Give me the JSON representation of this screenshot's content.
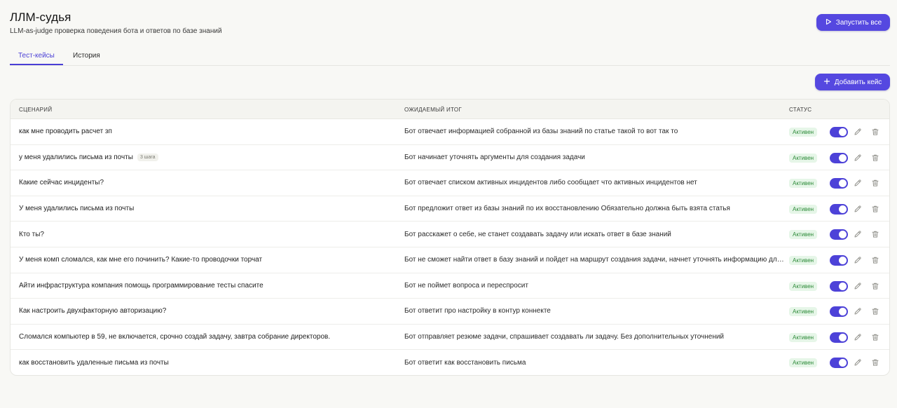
{
  "header": {
    "title": "ЛЛМ-судья",
    "subtitle": "LLM-as-judge проверка поведения бота и ответов по базе знаний",
    "run_all_label": "Запустить все"
  },
  "tabs": [
    {
      "label": "Тест-кейсы",
      "active": true
    },
    {
      "label": "История",
      "active": false
    }
  ],
  "toolbar": {
    "add_case_label": "Добавить кейс"
  },
  "table": {
    "columns": {
      "scenario": "СЦЕНАРИЙ",
      "expected": "ОЖИДАЕМЫЙ ИТОГ",
      "status": "СТАТУС"
    },
    "rows": [
      {
        "scenario": "как мне проводить расчет зп",
        "steps": "",
        "expected": "Бот отвечает информацией собранной из базы знаний по статье такой то вот так то",
        "status": "Активен",
        "enabled": true
      },
      {
        "scenario": "у меня удалились письма из почты",
        "steps": "3 шага",
        "expected": "Бот начинает уточнять аргументы для создания задачи",
        "status": "Активен",
        "enabled": true
      },
      {
        "scenario": "Какие сейчас инциденты?",
        "steps": "",
        "expected": "Бот отвечает списком активных инцидентов либо сообщает что активных инцидентов нет",
        "status": "Активен",
        "enabled": true
      },
      {
        "scenario": "У меня удалились письма из почты",
        "steps": "",
        "expected": "Бот предложит ответ из базы знаний по их восстановлению Обязательно должна быть взята статья",
        "status": "Активен",
        "enabled": true
      },
      {
        "scenario": "Кто ты?",
        "steps": "",
        "expected": "Бот расскажет о себе, не станет создавать задачу или искать ответ в базе знаний",
        "status": "Активен",
        "enabled": true
      },
      {
        "scenario": "У меня комп сломался, как мне его починить? Какие-то проводочки торчат",
        "steps": "",
        "expected": "Бот не сможет найти ответ в базу знаний и пойдет на маршрут создания задачи, начнет уточнять информацию для создания задачи",
        "status": "Активен",
        "enabled": true
      },
      {
        "scenario": "Айти инфраструктура компания помощь программирование тесты спасите",
        "steps": "",
        "expected": "Бот не поймет вопроса и переспросит",
        "status": "Активен",
        "enabled": true
      },
      {
        "scenario": "Как настроить двухфакторную авторизацию?",
        "steps": "",
        "expected": "Бот ответит про настройку в контур коннекте",
        "status": "Активен",
        "enabled": true
      },
      {
        "scenario": "Сломался компьютер в 59, не включается, срочно создай задачу, завтра собрание директоров.",
        "steps": "",
        "expected": "Бот отправляет резюме задачи, спрашивает создавать ли задачу. Без дополнительных уточнений",
        "status": "Активен",
        "enabled": true
      },
      {
        "scenario": "как восстановить удаленные письма из почты",
        "steps": "",
        "expected": "Бот ответит как восстановить письма",
        "status": "Активен",
        "enabled": true
      }
    ]
  },
  "icons": {
    "run": "play-icon",
    "add": "plus-icon",
    "edit": "pencil-icon",
    "delete": "trash-icon"
  },
  "colors": {
    "accent": "#5548e0",
    "status_bg": "#e6f6e8",
    "status_text": "#2e8b3a"
  }
}
